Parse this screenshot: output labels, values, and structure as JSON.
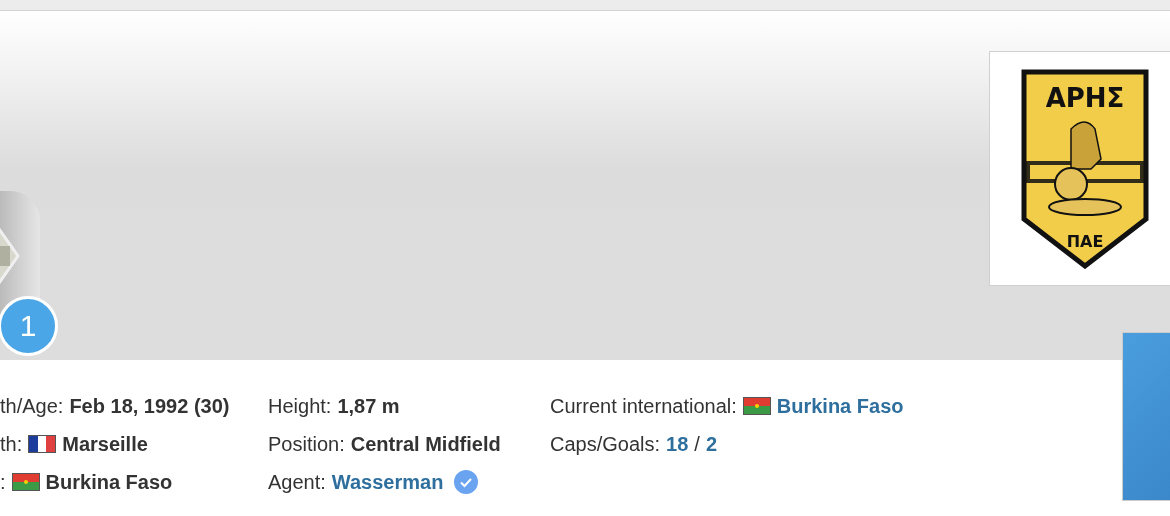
{
  "header": {
    "shirt_number": "1",
    "club_logo": {
      "top_text": "ΑΡΗΣ",
      "bottom_text": "ΠΑΕ"
    }
  },
  "info_columns": [
    [
      {
        "label": "th/Age:",
        "value": "Feb 18, 1992 (30)",
        "kind": "text"
      },
      {
        "label": "th:",
        "value": "Marseille",
        "kind": "text",
        "flag": {
          "kind": "france"
        }
      },
      {
        "label": ":",
        "value": "Burkina Faso",
        "kind": "text",
        "flag": {
          "kind": "burkina"
        }
      }
    ],
    [
      {
        "label": "Height:",
        "value": "1,87 m",
        "kind": "text"
      },
      {
        "label": "Position:",
        "value": "Central Midfield",
        "kind": "text"
      },
      {
        "label": "Agent:",
        "value": "Wasserman",
        "kind": "link",
        "verified": true
      }
    ],
    [
      {
        "label": "Current international:",
        "value": "Burkina Faso",
        "kind": "link",
        "flag": {
          "kind": "burkina"
        }
      },
      {
        "label": "Caps/Goals:",
        "value": "18",
        "separator": "/",
        "value2": "2",
        "kind": "pair"
      }
    ]
  ]
}
